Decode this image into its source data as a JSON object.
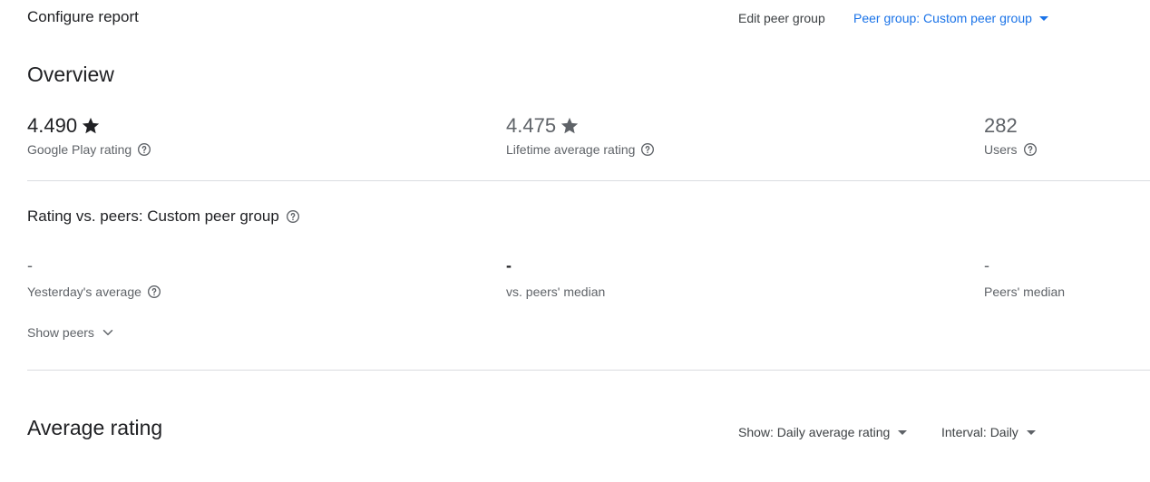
{
  "header": {
    "title": "Configure report",
    "edit_peer_group": "Edit peer group",
    "peer_group_selector": "Peer group: Custom peer group"
  },
  "overview": {
    "title": "Overview",
    "metrics": [
      {
        "value": "4.490",
        "label": "Google Play rating",
        "icon": "star-icon"
      },
      {
        "value": "4.475",
        "label": "Lifetime average rating",
        "icon": "star-icon"
      },
      {
        "value": "282",
        "label": "Users"
      }
    ]
  },
  "peers": {
    "title": "Rating vs. peers: Custom peer group",
    "metrics": [
      {
        "value": "-",
        "label": "Yesterday's average"
      },
      {
        "value": "-",
        "label": "vs. peers' median"
      },
      {
        "value": "-",
        "label": "Peers' median"
      }
    ],
    "show_peers": "Show peers"
  },
  "average_rating": {
    "title": "Average rating",
    "show_dropdown": "Show: Daily average rating",
    "interval_dropdown": "Interval: Daily"
  },
  "colors": {
    "accent": "#1a73e8",
    "text": "#202124",
    "muted": "#5f6368",
    "divider": "#dadce0"
  }
}
